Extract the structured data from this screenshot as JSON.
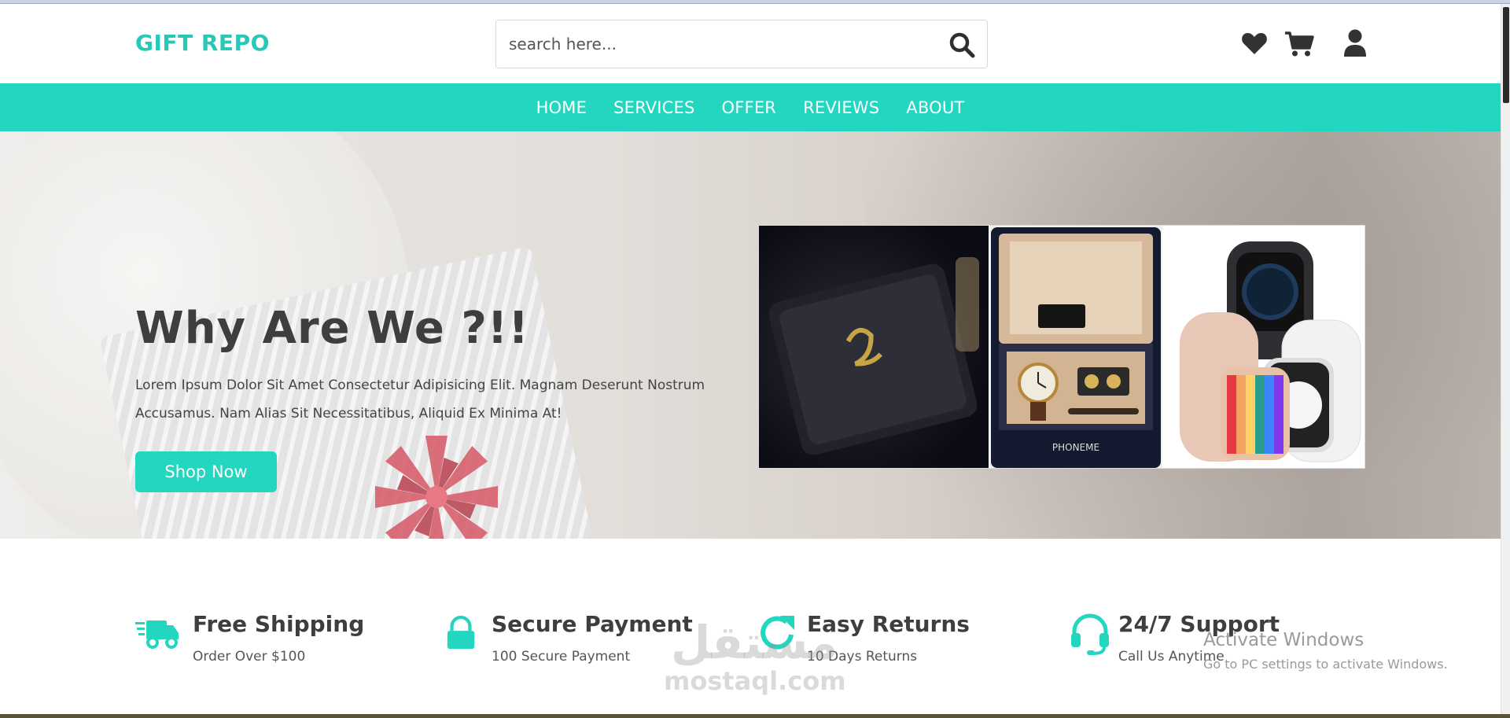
{
  "header": {
    "logo": "GIFT REPO",
    "search_placeholder": "search here...",
    "icons": [
      "heart-icon",
      "cart-icon",
      "user-icon",
      "search-icon"
    ]
  },
  "nav": {
    "items": [
      "HOME",
      "SERVICES",
      "OFFER",
      "REVIEWS",
      "ABOUT"
    ]
  },
  "hero": {
    "title": "Why Are We ?!!",
    "text": "Lorem Ipsum Dolor Sit Amet Consectetur Adipisicing Elit. Magnam Deserunt Nostrum Accusamus. Nam Alias Sit Necessitatibus, Aliquid Ex Minima At!",
    "button": "Shop Now",
    "product_box_brand": "PHONEME"
  },
  "features": [
    {
      "title": "Free Shipping",
      "subtitle": "Order Over $100",
      "icon": "shipping-truck-icon"
    },
    {
      "title": "Secure Payment",
      "subtitle": "100 Secure Payment",
      "icon": "lock-icon"
    },
    {
      "title": "Easy Returns",
      "subtitle": "10 Days Returns",
      "icon": "redo-icon"
    },
    {
      "title": "24/7 Support",
      "subtitle": "Call Us Anytime",
      "icon": "headset-icon"
    }
  ],
  "os_overlay": {
    "title": "Activate Windows",
    "subtitle": "Go to PC settings to activate Windows."
  },
  "watermark": {
    "arabic": "مستقل",
    "latin": "mostaql.com"
  },
  "colors": {
    "accent": "#22d6c0",
    "logo": "#27c8b5",
    "heading": "#3e3e3e"
  }
}
